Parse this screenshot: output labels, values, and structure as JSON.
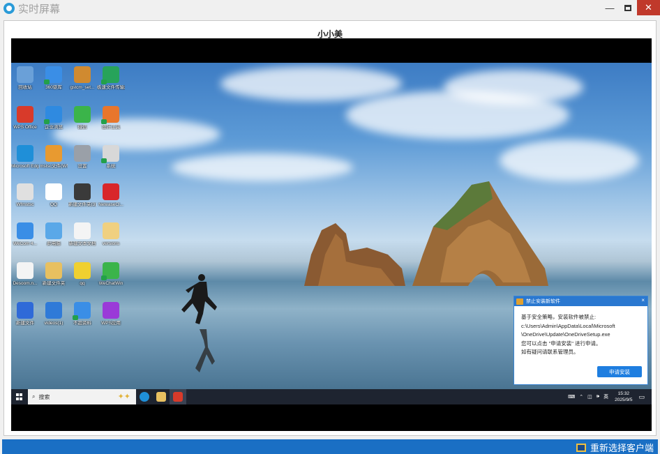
{
  "window": {
    "title": "实时屏幕",
    "minimize_label": "—",
    "close_label": "✕"
  },
  "client": {
    "name": "小小美"
  },
  "desktop": {
    "icons": [
      {
        "label": "回收站",
        "color": "#6aa0d8"
      },
      {
        "label": "360驱库",
        "color": "#3a8ee6"
      },
      {
        "label": "gstcm_set...",
        "color": "#d08a30"
      },
      {
        "label": "极速文件传输器",
        "color": "#27a35a"
      },
      {
        "label": "WPS Office",
        "color": "#d83a2a"
      },
      {
        "label": "企业浏览",
        "color": "#2f8ae0"
      },
      {
        "label": "微信",
        "color": "#3bb44a"
      },
      {
        "label": "设计工具",
        "color": "#e8762c"
      },
      {
        "label": "Microsoft Edge",
        "color": "#1f8fd8"
      },
      {
        "label": "mstsc文件(Wfmstsc)...",
        "color": "#e89a30"
      },
      {
        "label": "设置",
        "color": "#9aa0a8"
      },
      {
        "label": "系统",
        "color": "#d8d8d8"
      },
      {
        "label": "Wfmstsc",
        "color": "#e0e0e0"
      },
      {
        "label": "QQ",
        "color": "#ffffff"
      },
      {
        "label": "新建文件夹(3)",
        "color": "#3a3a3a"
      },
      {
        "label": "NeteaseCl...",
        "color": "#d8262a"
      },
      {
        "label": "WeCom 4...",
        "color": "#3a8ee6"
      },
      {
        "label": "此电脑",
        "color": "#5aa8e8"
      },
      {
        "label": "新建文本文档",
        "color": "#f4f4f4"
      },
      {
        "label": "versions",
        "color": "#f0d080"
      },
      {
        "label": "Desoom.n...",
        "color": "#f4f4f4"
      },
      {
        "label": "新建文件夹",
        "color": "#e8c060"
      },
      {
        "label": "qq",
        "color": "#f0d030"
      },
      {
        "label": "WeChatWin",
        "color": "#3bb44a"
      },
      {
        "label": "新建文件",
        "color": "#2f6ad8"
      },
      {
        "label": "videos(1)",
        "color": "#2f7ad8"
      },
      {
        "label": "不超资料",
        "color": "#3a8ee6"
      },
      {
        "label": "WPS应用",
        "color": "#9a3ad8"
      }
    ]
  },
  "taskbar": {
    "search_placeholder": "搜索",
    "tray": {
      "language": "英",
      "time": "15:32",
      "date": "2025/9/5"
    }
  },
  "notice": {
    "title": "禁止安装新软件",
    "line1": "基于安全策略，安装软件被禁止:",
    "line2": "c:\\Users\\Admin\\AppData\\Local\\Microsoft",
    "line3": "\\OneDrive\\Update\\OneDriveSetup.exe",
    "line4": "您可以点击 \"申请安装\" 进行申请。",
    "line5": "如有疑问请联系管理员。",
    "button": "申请安装",
    "close": "×"
  },
  "footer": {
    "reselect_label": "重新选择客户端"
  }
}
